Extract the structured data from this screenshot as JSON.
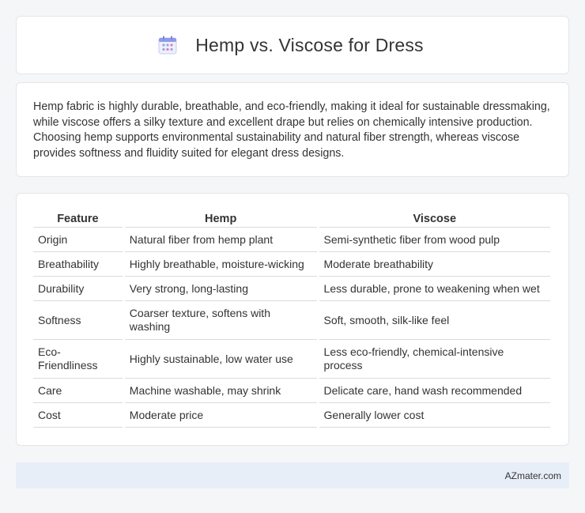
{
  "header": {
    "title": "Hemp vs. Viscose for Dress",
    "icon": "calendar-icon"
  },
  "summary": {
    "text": "Hemp fabric is highly durable, breathable, and eco-friendly, making it ideal for sustainable dressmaking, while viscose offers a silky texture and excellent drape but relies on chemically intensive production. Choosing hemp supports environmental sustainability and natural fiber strength, whereas viscose provides softness and fluidity suited for elegant dress designs."
  },
  "table": {
    "headers": [
      "Feature",
      "Hemp",
      "Viscose"
    ],
    "rows": [
      [
        "Origin",
        "Natural fiber from hemp plant",
        "Semi-synthetic fiber from wood pulp"
      ],
      [
        "Breathability",
        "Highly breathable, moisture-wicking",
        "Moderate breathability"
      ],
      [
        "Durability",
        "Very strong, long-lasting",
        "Less durable, prone to weakening when wet"
      ],
      [
        "Softness",
        "Coarser texture, softens with washing",
        "Soft, smooth, silk-like feel"
      ],
      [
        "Eco-Friendliness",
        "Highly sustainable, low water use",
        "Less eco-friendly, chemical-intensive process"
      ],
      [
        "Care",
        "Machine washable, may shrink",
        "Delicate care, hand wash recommended"
      ],
      [
        "Cost",
        "Moderate price",
        "Generally lower cost"
      ]
    ]
  },
  "footer": {
    "brand": "AZmater.com"
  }
}
